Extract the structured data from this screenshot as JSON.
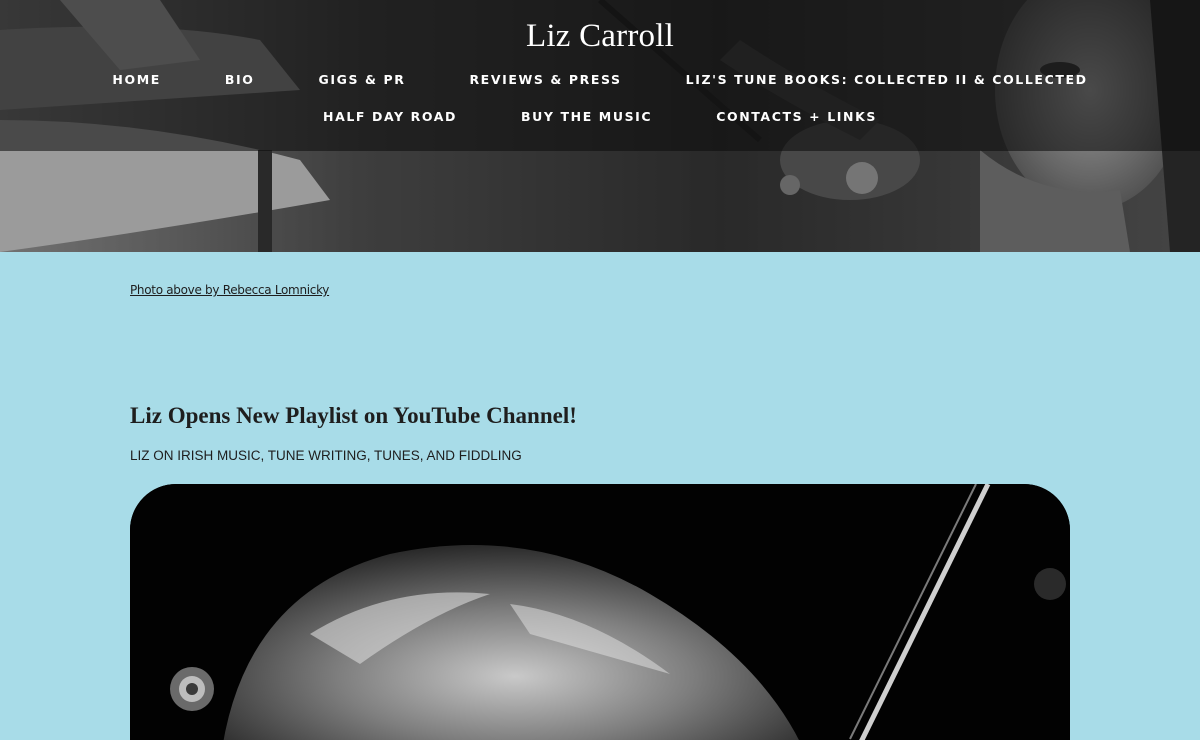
{
  "site": {
    "title": "Liz Carroll"
  },
  "nav": {
    "row1": [
      {
        "label": "HOME"
      },
      {
        "label": "BIO"
      },
      {
        "label": "GIGS & PR"
      },
      {
        "label": "REVIEWS & PRESS"
      },
      {
        "label": "LIZ'S TUNE BOOKS: COLLECTED II & COLLECTED"
      }
    ],
    "row2": [
      {
        "label": "HALF DAY ROAD"
      },
      {
        "label": "BUY THE MUSIC"
      },
      {
        "label": "CONTACTS + LINKS"
      }
    ]
  },
  "hero": {
    "image": "black-and-white photo of fiddler with violin"
  },
  "content": {
    "photo_credit": "Photo above by Rebecca Lomnicky",
    "post_title": "Liz Opens New Playlist on YouTube Channel!",
    "post_subtitle": "LIZ ON IRISH MUSIC, TUNE WRITING, TUNES, AND FIDDLING",
    "feature_image": "black-and-white close-up photo of fiddler playing"
  },
  "colors": {
    "page_background": "#a8dce8",
    "header_overlay": "#121212",
    "text": "#1e1e1e"
  }
}
